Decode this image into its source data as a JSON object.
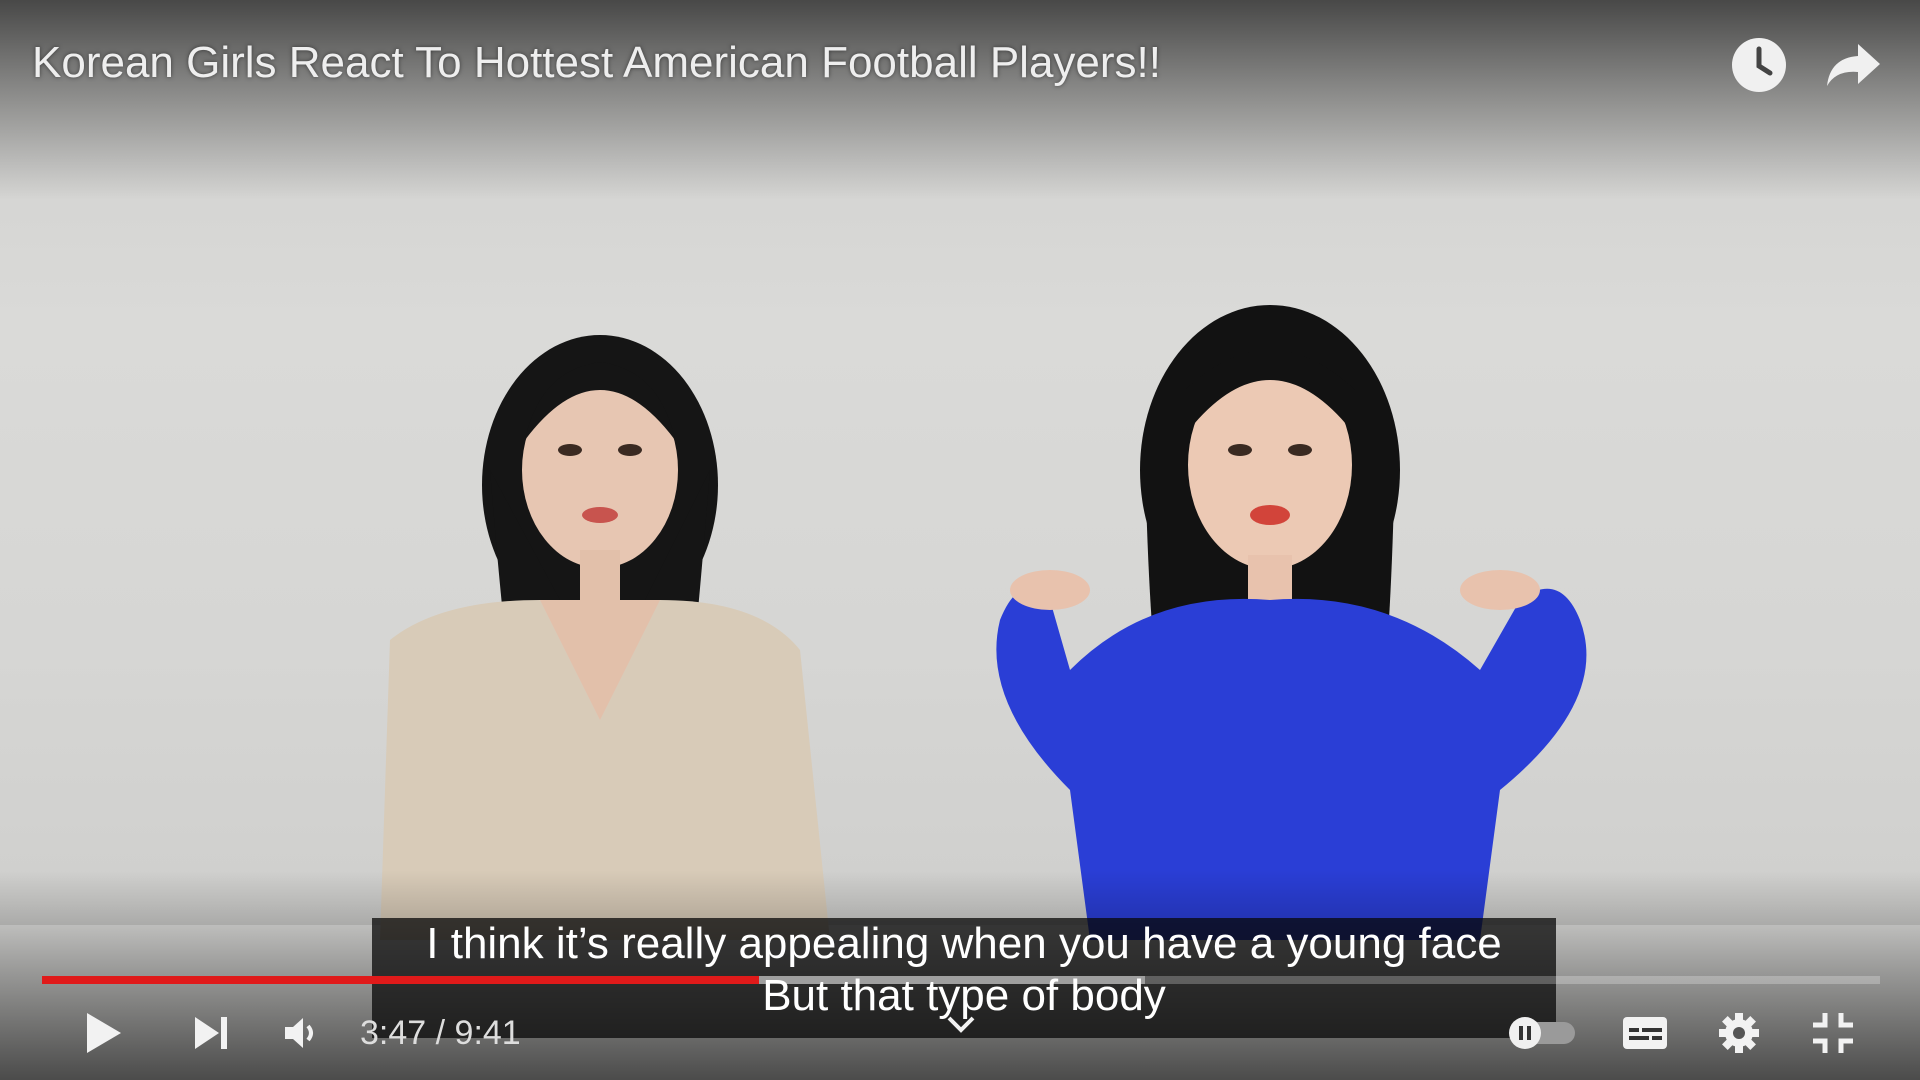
{
  "video": {
    "title": "Korean Girls React To Hottest American Football Players!!",
    "progress_fraction": 0.39,
    "loaded_fraction": 0.6
  },
  "captions": {
    "line1": "I think it’s really appealing when you have a young face",
    "line2": "But that type of body"
  },
  "controls": {
    "current_time": "3:47",
    "separator": " / ",
    "duration": "9:41",
    "icons": [
      "play-icon",
      "next-icon",
      "volume-icon",
      "autoplay-toggle-icon",
      "subtitles-icon",
      "settings-icon",
      "exit-fullscreen-icon",
      "watch-later-icon",
      "share-icon"
    ]
  },
  "colors": {
    "progress_played": "#e01a1a",
    "shirt_blue": "#2a3ed6"
  }
}
